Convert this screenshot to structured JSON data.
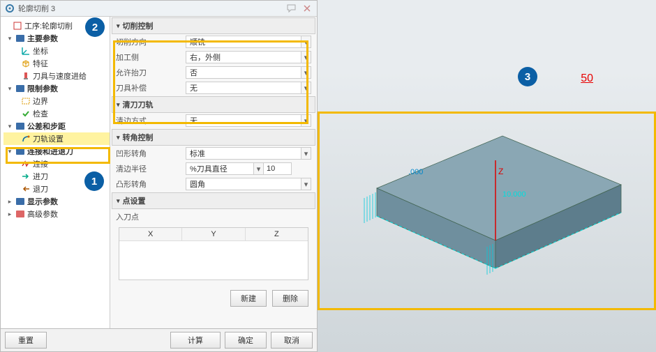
{
  "title": "轮廓切削 3",
  "tree": {
    "root": "工序:轮廓切削",
    "main_params": "主要参数",
    "coord": "坐标",
    "feature": "特征",
    "tool": "刀具与速度进给",
    "limit_params": "限制参数",
    "boundary": "边界",
    "check": "检查",
    "tolerance": "公差和步距",
    "toolpath_settings": "刀轨设置",
    "connect_inout": "连接和进退刀",
    "connect": "连接",
    "approach": "进刀",
    "retract": "退刀",
    "display_params": "显示参数",
    "advanced_params": "高级参数"
  },
  "groups": {
    "cut_control": "切削控制",
    "cleanup": "清刀刀轨",
    "corner": "转角控制",
    "point": "点设置"
  },
  "rows": {
    "cut_dir": {
      "label": "切削方向",
      "value": "顺铣"
    },
    "machine_side": {
      "label": "加工侧",
      "value": "右，外侧"
    },
    "allow_lift": {
      "label": "允许抬刀",
      "value": "否"
    },
    "cutter_comp": {
      "label": "刀具补偿",
      "value": "无"
    },
    "clean_method": {
      "label": "清边方式",
      "value": "无"
    },
    "concave": {
      "label": "凹形转角",
      "value": "标准"
    },
    "clean_radius": {
      "label": "清边半径",
      "value": "%刀具直径",
      "num": "10"
    },
    "convex": {
      "label": "凸形转角",
      "value": "圆角"
    },
    "entry_point": "入刀点"
  },
  "table": {
    "x": "X",
    "y": "Y",
    "z": "Z"
  },
  "buttons": {
    "new": "新建",
    "delete": "删除",
    "reset": "重置",
    "calc": "计算",
    "ok": "确定",
    "cancel": "取消"
  },
  "annotations": {
    "one": "1",
    "two": "2",
    "three": "3"
  },
  "viewport": {
    "dim": "50"
  }
}
